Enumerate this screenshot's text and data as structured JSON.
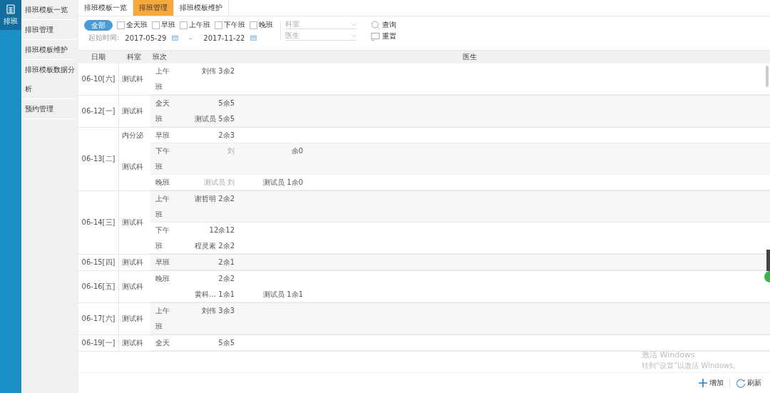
{
  "rail": {
    "label": "排班"
  },
  "sidebar": {
    "items": [
      {
        "label": "排班模板一览",
        "selected": false
      },
      {
        "label": "排班管理",
        "selected": false
      },
      {
        "label": "排班模板维护",
        "selected": false
      },
      {
        "label": "排班模板数据分析",
        "selected": false
      },
      {
        "label": "预约管理",
        "selected": false
      }
    ]
  },
  "tabs": [
    {
      "label": "排班模板一览",
      "selected": false
    },
    {
      "label": "排班管理",
      "selected": true
    },
    {
      "label": "排班模板维护",
      "selected": false
    }
  ],
  "filters": {
    "all_button": {
      "label": "全部",
      "selected": true
    },
    "shift_checkboxes": [
      {
        "label": "全天班",
        "checked": false
      },
      {
        "label": "早班",
        "checked": false
      },
      {
        "label": "上午班",
        "checked": false
      },
      {
        "label": "下午班",
        "checked": false
      },
      {
        "label": "晚班",
        "checked": false
      }
    ],
    "date_range": {
      "label": "起始时间:",
      "start": "2017-05-29",
      "separator": "–",
      "end": "2017-11-22"
    },
    "selects": [
      {
        "placeholder": "科室"
      },
      {
        "placeholder": "医生"
      }
    ],
    "buttons": [
      {
        "label": "查询",
        "kind": "search"
      },
      {
        "label": "重置",
        "kind": "reset"
      }
    ]
  },
  "table": {
    "columns": [
      "日期",
      "科室",
      "班次",
      "医生"
    ],
    "groups": [
      {
        "date": "06-10[六]",
        "departments": [
          {
            "name": "测试科",
            "shifts": [
              {
                "name": "上午班",
                "lines": [
                  [
                    {
                      "text": "刘伟 3余2",
                      "muted": false
                    }
                  ]
                ]
              }
            ]
          }
        ]
      },
      {
        "date": "06-12[一]",
        "departments": [
          {
            "name": "测试科",
            "shifts": [
              {
                "name": "全天班",
                "lines": [
                  [
                    {
                      "text": "5余5",
                      "muted": false
                    }
                  ],
                  [
                    {
                      "text": "测试员 5余5",
                      "muted": false
                    }
                  ]
                ]
              }
            ]
          }
        ]
      },
      {
        "date": "06-13[二]",
        "departments": [
          {
            "name": "内分泌",
            "shifts": [
              {
                "name": "早班",
                "lines": [
                  [
                    {
                      "text": "2余3",
                      "muted": false
                    }
                  ]
                ]
              }
            ]
          },
          {
            "name": "测试科",
            "shifts": [
              {
                "name": "下午班",
                "lines": [
                  [
                    {
                      "text": "刘",
                      "muted": true
                    },
                    {
                      "text": "余0",
                      "muted": false
                    }
                  ]
                ]
              },
              {
                "name": "晚班",
                "lines": [
                  [
                    {
                      "text": "测试员 刘",
                      "muted": true
                    },
                    {
                      "text": "测试员 1余0",
                      "muted": false
                    }
                  ]
                ]
              }
            ]
          }
        ]
      },
      {
        "date": "06-14[三]",
        "departments": [
          {
            "name": "测试科",
            "shifts": [
              {
                "name": "上午班",
                "lines": [
                  [
                    {
                      "text": "谢哲明 2余2",
                      "muted": false
                    }
                  ]
                ]
              },
              {
                "name": "下午班",
                "lines": [
                  [
                    {
                      "text": "12余12",
                      "muted": false
                    }
                  ],
                  [
                    {
                      "text": "程灵素 2余2",
                      "muted": false
                    }
                  ]
                ]
              }
            ]
          }
        ]
      },
      {
        "date": "06-15[四]",
        "departments": [
          {
            "name": "测试科",
            "shifts": [
              {
                "name": "早班",
                "lines": [
                  [
                    {
                      "text": "2余1",
                      "muted": false
                    }
                  ]
                ]
              }
            ]
          }
        ]
      },
      {
        "date": "06-16[五]",
        "departments": [
          {
            "name": "测试科",
            "shifts": [
              {
                "name": "晚班",
                "lines": [
                  [
                    {
                      "text": "2余2",
                      "muted": false
                    }
                  ],
                  [
                    {
                      "text": "黄科… 1余1",
                      "muted": false
                    },
                    {
                      "text": "测试员 1余1",
                      "muted": false
                    }
                  ]
                ]
              }
            ]
          }
        ]
      },
      {
        "date": "06-17[六]",
        "departments": [
          {
            "name": "测试科",
            "shifts": [
              {
                "name": "上午班",
                "lines": [
                  [
                    {
                      "text": "刘伟 3余3",
                      "muted": false
                    }
                  ]
                ]
              }
            ]
          }
        ]
      },
      {
        "date": "06-19[一]",
        "departments": [
          {
            "name": "测试科",
            "shifts": [
              {
                "name": "全天",
                "lines": [
                  [
                    {
                      "text": "5余5",
                      "muted": false
                    }
                  ]
                ]
              }
            ]
          }
        ]
      }
    ]
  },
  "footer": {
    "buttons": [
      {
        "label": "增加",
        "kind": "add"
      },
      {
        "label": "刷新",
        "kind": "refresh"
      }
    ]
  },
  "activation_notice": {
    "title": "激活 Windows",
    "text": "转到“设置”以激活 Windows。"
  }
}
